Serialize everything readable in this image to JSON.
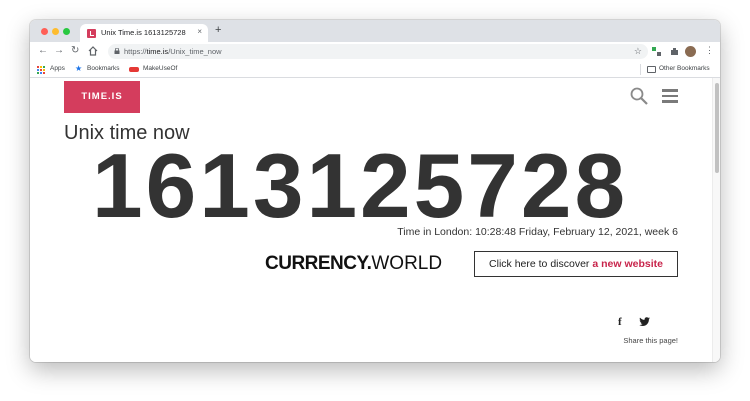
{
  "browser": {
    "tab_title": "Unix Time.is 1613125728",
    "tab_close": "×",
    "new_tab": "+",
    "url_prefix": "https://",
    "url_host": "time.is",
    "url_path": "/Unix_time_now"
  },
  "bookmarks": {
    "items": [
      {
        "label": "Apps"
      },
      {
        "label": "Bookmarks"
      },
      {
        "label": "MakeUseOf"
      }
    ],
    "other": "Other Bookmarks"
  },
  "page": {
    "logo": "TIME.IS",
    "heading": "Unix time now",
    "unix_value": "1613125728",
    "london_time": "Time in London: 10:28:48 Friday, February 12, 2021, week 6",
    "currency_logo_bold": "CURRENCY.",
    "currency_logo_light": "WORLD",
    "currency_button_prefix": "Click here to discover ",
    "currency_button_accent": "a new website",
    "share_text": "Share this page!"
  },
  "colors": {
    "brand": "#d43d5d",
    "accent": "#c8244b",
    "text_dark": "#333333"
  },
  "icons": [
    "search-icon",
    "menu-icon",
    "facebook-icon",
    "twitter-icon",
    "star-icon",
    "lock-icon"
  ]
}
